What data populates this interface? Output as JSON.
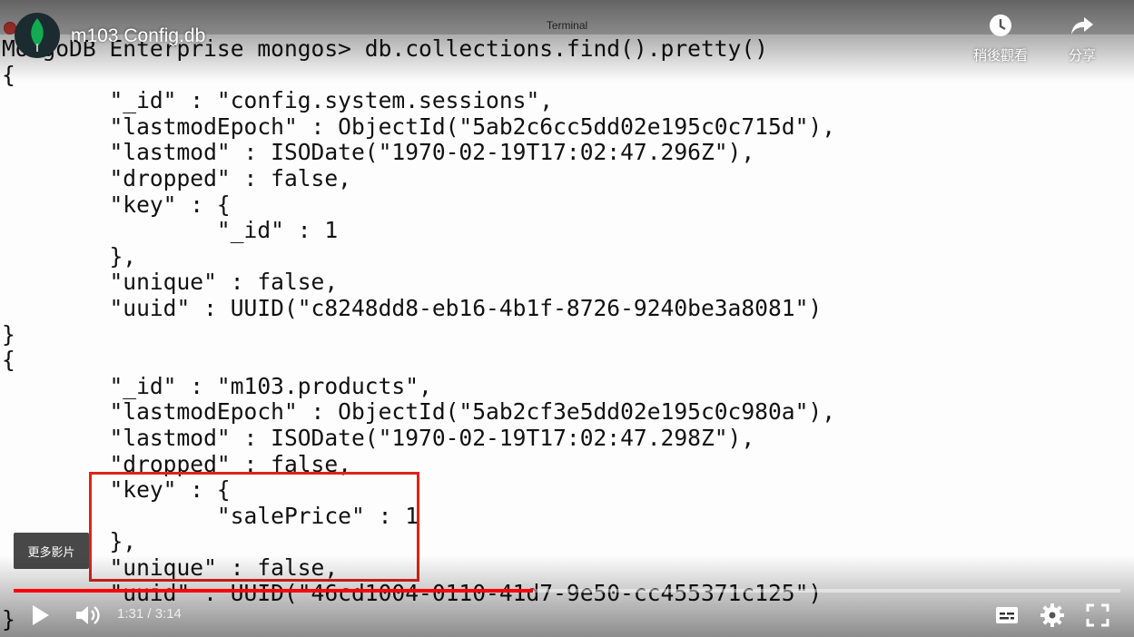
{
  "terminal": {
    "window_title": "Terminal",
    "lines": [
      "MongoDB Enterprise mongos> db.collections.find().pretty()",
      "{",
      "        \"_id\" : \"config.system.sessions\",",
      "        \"lastmodEpoch\" : ObjectId(\"5ab2c6cc5dd02e195c0c715d\"),",
      "        \"lastmod\" : ISODate(\"1970-02-19T17:02:47.296Z\"),",
      "        \"dropped\" : false,",
      "        \"key\" : {",
      "                \"_id\" : 1",
      "        },",
      "        \"unique\" : false,",
      "        \"uuid\" : UUID(\"c8248dd8-eb16-4b1f-8726-9240be3a8081\")",
      "}",
      "{",
      "        \"_id\" : \"m103.products\",",
      "        \"lastmodEpoch\" : ObjectId(\"5ab2cf3e5dd02e195c0c980a\"),",
      "        \"lastmod\" : ISODate(\"1970-02-19T17:02:47.298Z\"),",
      "        \"dropped\" : false,",
      "        \"key\" : {",
      "                \"salePrice\" : 1",
      "        },",
      "        \"unique\" : false,",
      "        \"uuid\" : UUID(\"46cd1004-0110-41d7-9e50-cc455371c125\")",
      "}"
    ]
  },
  "player": {
    "video_title": "m103 Config.db",
    "watch_later_label": "稍後觀看",
    "share_label": "分享",
    "more_videos_label": "更多影片",
    "time_display": "1:31 / 3:14",
    "progress_fraction": 0.469,
    "accent_color": "#ff0000"
  }
}
